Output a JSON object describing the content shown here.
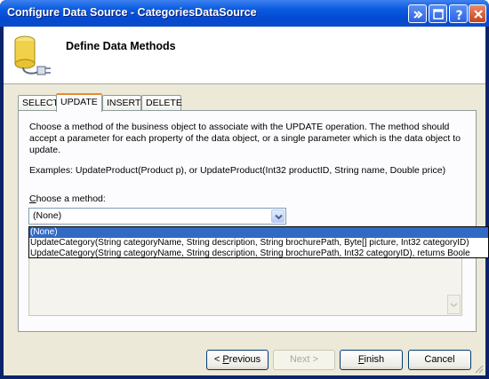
{
  "window": {
    "title": "Configure Data Source - CategoriesDataSource"
  },
  "header": {
    "title": "Define Data Methods",
    "icon": "database-plug-icon"
  },
  "tabs": [
    {
      "label": "SELECT",
      "active": false
    },
    {
      "label": "UPDATE",
      "active": true
    },
    {
      "label": "INSERT",
      "active": false
    },
    {
      "label": "DELETE",
      "active": false
    }
  ],
  "panel": {
    "description": "Choose a method of the business object to associate with the UPDATE operation. The method should accept a parameter for each property of the data object, or a single parameter which is the data object to update.",
    "examples": "Examples: UpdateProduct(Product p), or UpdateProduct(Int32 productID, String name, Double price)",
    "choose_label_prefix": "",
    "choose_label_hotkey": "C",
    "choose_label_rest": "hoose a method:",
    "method_selected": "(None)",
    "method_options": [
      {
        "label": "(None)",
        "selected": true
      },
      {
        "label": "UpdateCategory(String categoryName, String description, String brochurePath, Byte[] picture, Int32 categoryID)",
        "selected": false
      },
      {
        "label": "UpdateCategory(String categoryName, String description, String brochurePath, Int32 categoryID), returns Boole",
        "selected": false
      }
    ]
  },
  "footer": {
    "previous_pre": "< ",
    "previous_hotkey": "P",
    "previous_rest": "revious",
    "next_label": "Next >",
    "finish_hotkey": "F",
    "finish_rest": "inish",
    "cancel_label": "Cancel"
  },
  "colors": {
    "titlebar": "#0a5be0",
    "selection": "#316ac5",
    "active_tab_accent": "#e68b2c"
  }
}
